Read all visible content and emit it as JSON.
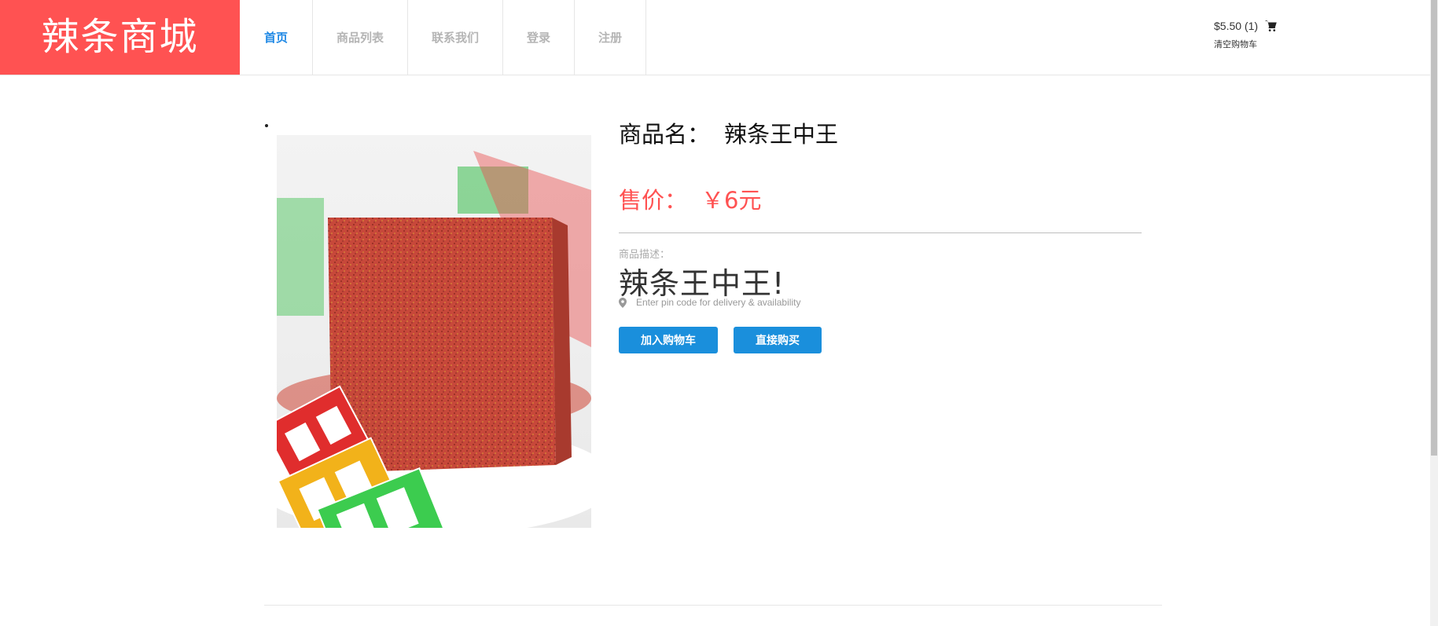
{
  "header": {
    "logo": "辣条商城",
    "nav": [
      {
        "label": "首页",
        "active": true
      },
      {
        "label": "商品列表",
        "active": false
      },
      {
        "label": "联系我们",
        "active": false
      },
      {
        "label": "登录",
        "active": false
      },
      {
        "label": "注册",
        "active": false
      }
    ],
    "cart": {
      "summary": "$5.50 (1)",
      "clear_label": "清空购物车",
      "icon": "cart-icon"
    }
  },
  "product": {
    "name_label": "商品名：",
    "name": "辣条王中王",
    "price_label": "售价：",
    "price": "￥6元",
    "desc_label": "商品描述：",
    "desc": "辣条王中王!",
    "pin_hint": "Enter pin code for delivery & availability",
    "pin_icon": "map-pin-icon",
    "add_to_cart_label": "加入购物车",
    "buy_now_label": "直接购买",
    "image_alt": "product-image"
  },
  "colors": {
    "brand": "#ff5252",
    "accent": "#1a8fdc",
    "nav_active": "#1e88e5"
  }
}
